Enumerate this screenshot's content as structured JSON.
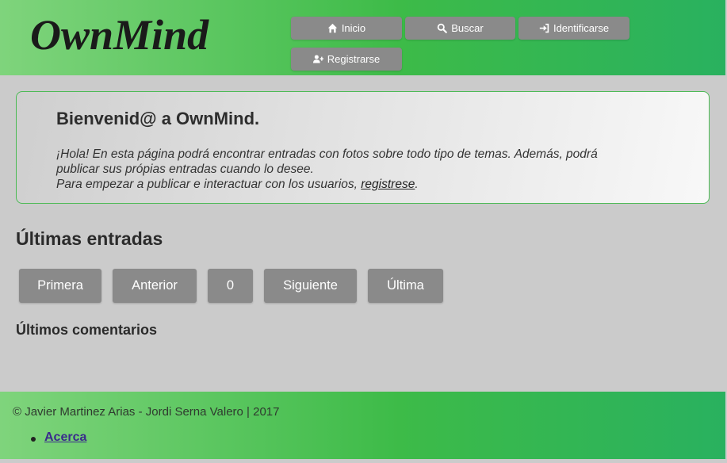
{
  "header": {
    "logo_text": "OwnMind",
    "nav": [
      {
        "label": "Inicio",
        "icon": "home-icon"
      },
      {
        "label": "Buscar",
        "icon": "search-icon"
      },
      {
        "label": "Identificarse",
        "icon": "sign-in-icon"
      },
      {
        "label": "Registrarse",
        "icon": "user-plus-icon"
      }
    ]
  },
  "welcome": {
    "title": "Bienvenid@ a OwnMind.",
    "line1": "¡Hola! En esta página podrá encontrar entradas con fotos sobre todo tipo de temas. Además, podrá publicar sus própias entradas cuando lo desee.",
    "line2_prefix": "Para empezar a publicar e interactuar con los usuarios, ",
    "link": "registrese",
    "line2_suffix": "."
  },
  "latest": {
    "title": "Últimas entradas",
    "pager": {
      "first": "Primera",
      "prev": "Anterior",
      "page": "0",
      "next": "Siguiente",
      "last": "Última"
    }
  },
  "comments": {
    "title": "Últimos comentarios"
  },
  "footer": {
    "copyright": "© Javier Martinez Arias - Jordi Serna Valero | 2017",
    "links": [
      {
        "label": "Acerca"
      }
    ]
  },
  "colors": {
    "header_green": "#3dbb48",
    "button_gray": "#8a8a8a",
    "background": "#cbcbcb",
    "border_green": "#4cba55"
  }
}
